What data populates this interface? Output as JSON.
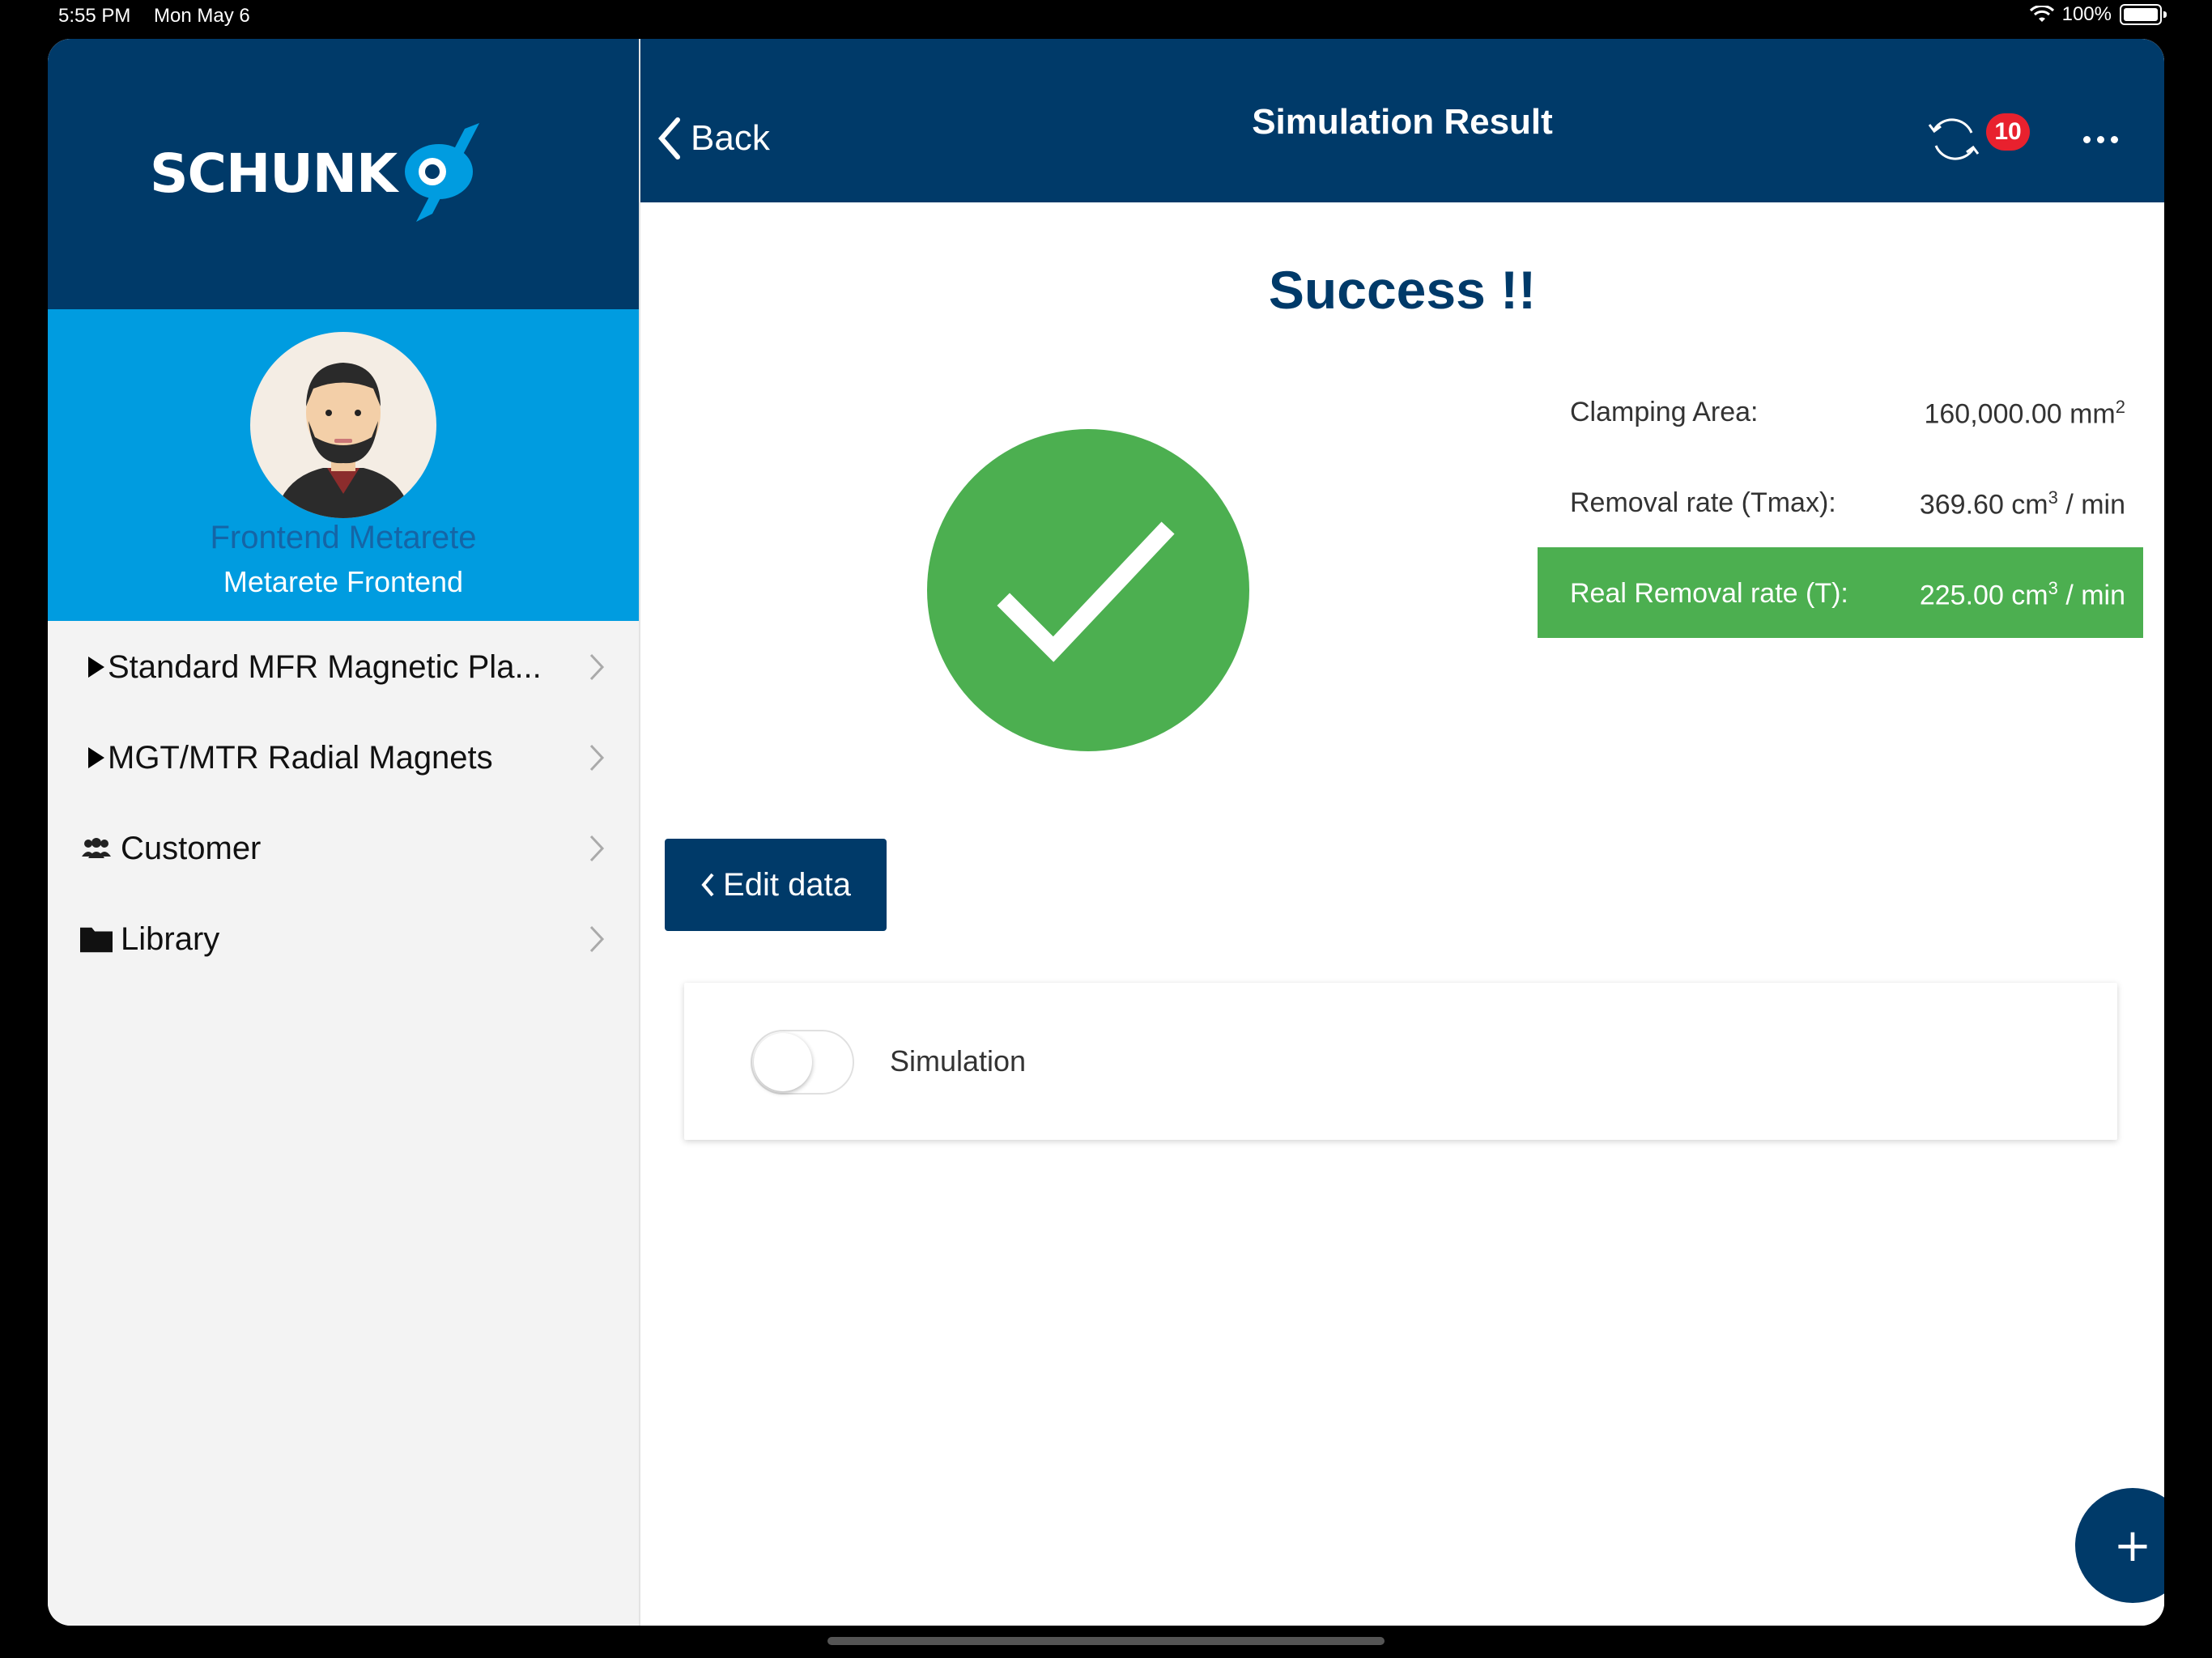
{
  "status_bar": {
    "time": "5:55 PM",
    "date": "Mon May 6",
    "battery": "100%"
  },
  "sidebar": {
    "logo_text": "SCHUNK",
    "profile": {
      "name": "Frontend Metarete",
      "subtitle": "Metarete Frontend"
    },
    "items": [
      {
        "label": "Standard MFR Magnetic Pla...",
        "icon": "triangle-right-icon"
      },
      {
        "label": "MGT/MTR Radial Magnets",
        "icon": "triangle-right-icon"
      },
      {
        "label": "Customer",
        "icon": "users-icon"
      },
      {
        "label": "Library",
        "icon": "folder-icon"
      }
    ]
  },
  "navbar": {
    "back_label": "Back",
    "title": "Simulation Result",
    "sync_count": "10"
  },
  "main": {
    "heading": "Success !!",
    "results": [
      {
        "label": "Clamping Area:",
        "value": "160,000.00 mm",
        "sup": "2",
        "unit": ""
      },
      {
        "label": "Removal rate (Tmax):",
        "value": "369.60 cm",
        "sup": "3",
        "unit": " / min"
      },
      {
        "label": "Real Removal rate (T):",
        "value": "225.00 cm",
        "sup": "3",
        "unit": " / min",
        "highlighted": true
      }
    ],
    "edit_button": "Edit data",
    "simulation_label": "Simulation",
    "simulation_toggle_on": false,
    "fab_symbol": "+"
  },
  "colors": {
    "primary": "#003a69",
    "accent": "#009ce0",
    "success": "#4caf50",
    "badge": "#e8212e"
  }
}
